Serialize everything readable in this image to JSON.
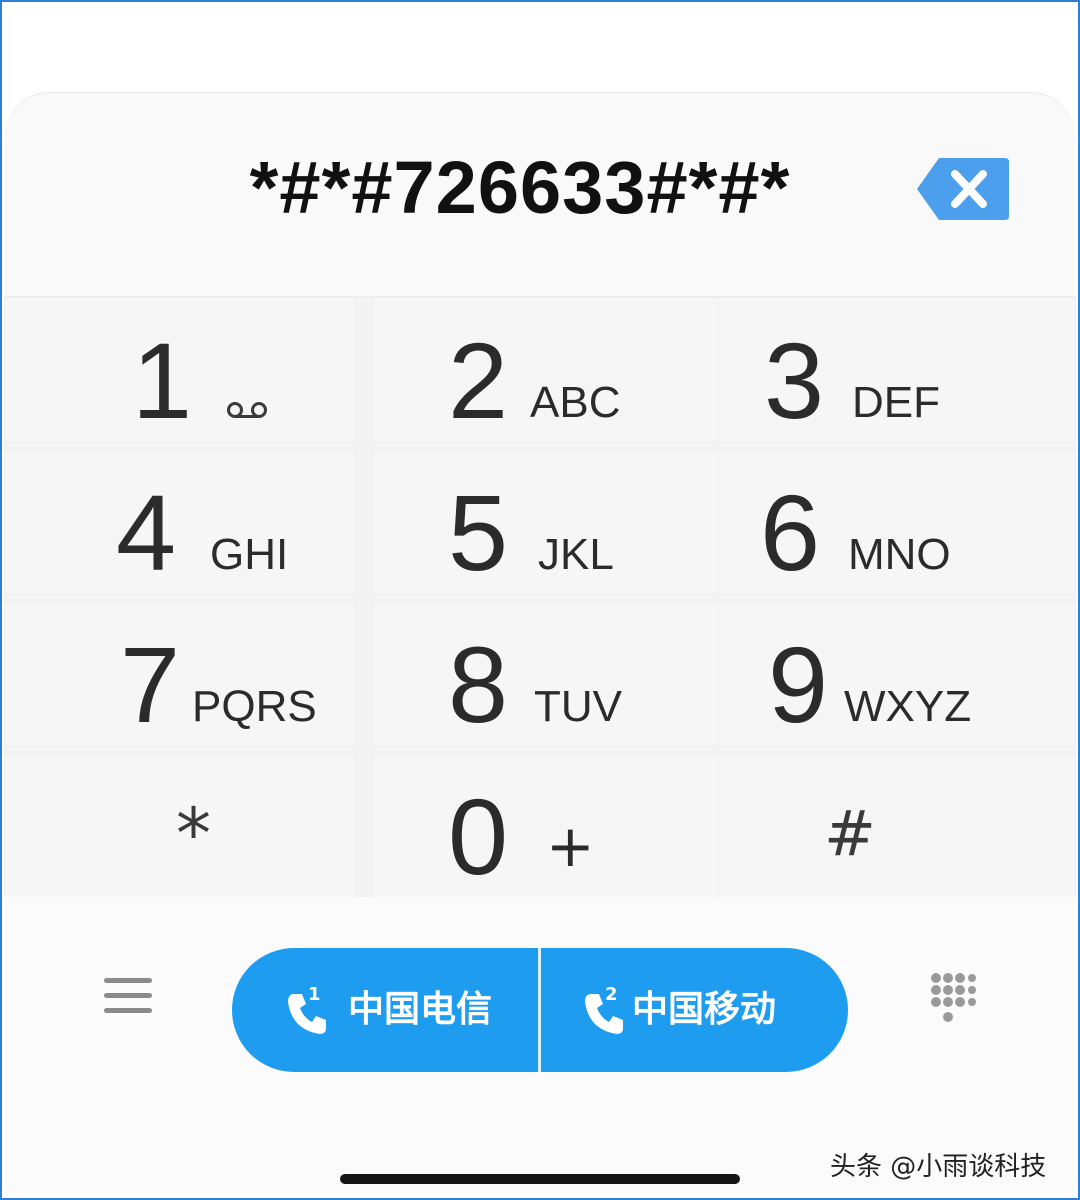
{
  "display": {
    "number": "*#*#726633#*#*"
  },
  "icons": {
    "backspace": "backspace-icon",
    "voicemail": "voicemail-icon",
    "menu": "menu-icon",
    "phone": "phone-icon",
    "dialpad": "dialpad-icon"
  },
  "keys": [
    {
      "digit": "1",
      "letters": ""
    },
    {
      "digit": "2",
      "letters": "ABC"
    },
    {
      "digit": "3",
      "letters": "DEF"
    },
    {
      "digit": "4",
      "letters": "GHI"
    },
    {
      "digit": "5",
      "letters": "JKL"
    },
    {
      "digit": "6",
      "letters": "MNO"
    },
    {
      "digit": "7",
      "letters": "PQRS"
    },
    {
      "digit": "8",
      "letters": "TUV"
    },
    {
      "digit": "9",
      "letters": "WXYZ"
    },
    {
      "digit": "*",
      "letters": ""
    },
    {
      "digit": "0",
      "letters": "+"
    },
    {
      "digit": "#",
      "letters": ""
    }
  ],
  "call_buttons": [
    {
      "sim": "1",
      "label": "中国电信"
    },
    {
      "sim": "2",
      "label": "中国移动"
    }
  ],
  "watermark": "头条 @小雨谈科技",
  "colors": {
    "accent": "#1e9cf0",
    "backspace": "#4b9fec",
    "key_text": "#2b2b2b"
  }
}
